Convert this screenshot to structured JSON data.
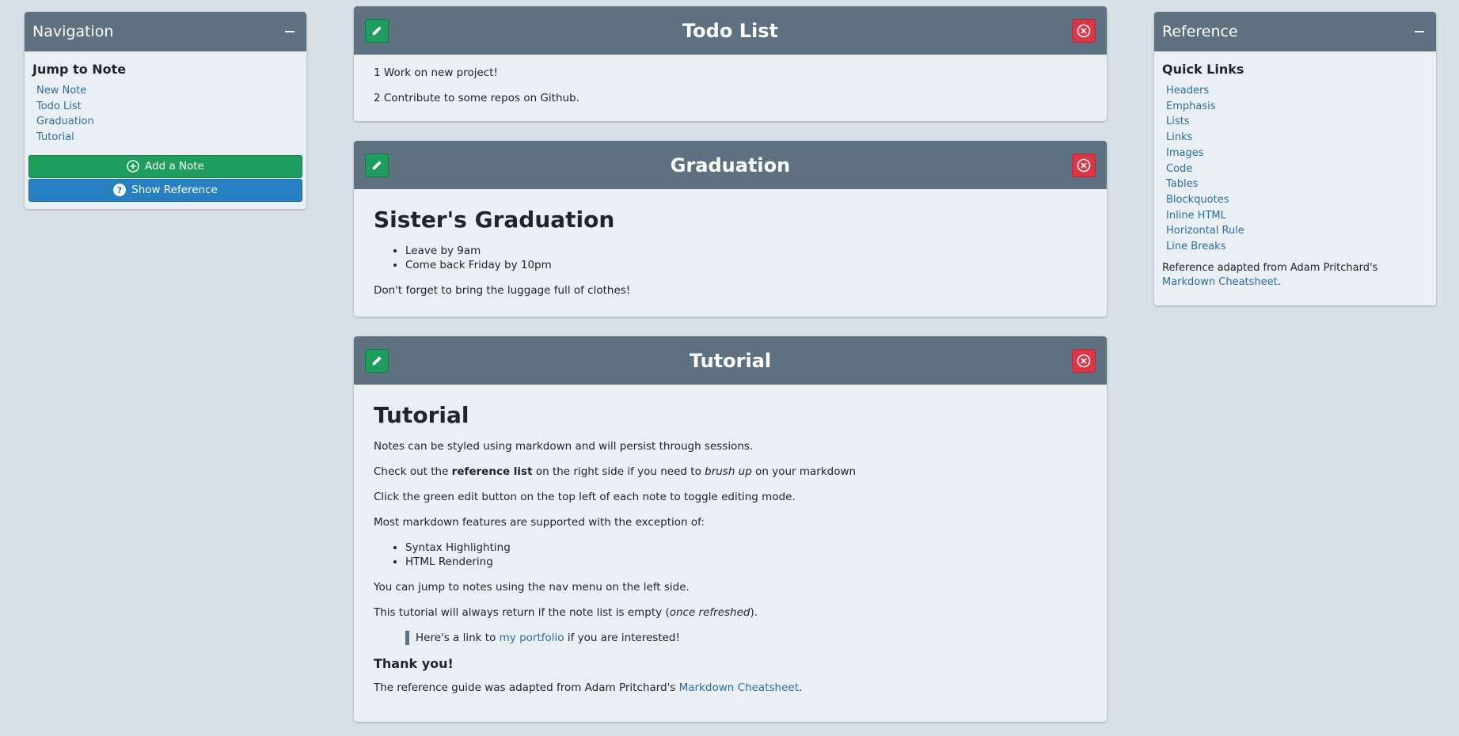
{
  "navigation": {
    "title": "Navigation",
    "subtitle": "Jump to Note",
    "links": [
      "New Note",
      "Todo List",
      "Graduation",
      "Tutorial"
    ],
    "add_button": "Add a Note",
    "reference_button": "Show Reference"
  },
  "reference": {
    "title": "Reference",
    "subtitle": "Quick Links",
    "links": [
      "Headers",
      "Emphasis",
      "Lists",
      "Links",
      "Images",
      "Code",
      "Tables",
      "Blockquotes",
      "Inline HTML",
      "Horizontal Rule",
      "Line Breaks"
    ],
    "footer_prefix": "Reference adapted from Adam Pritchard's ",
    "footer_link": "Markdown Cheatsheet",
    "footer_suffix": "."
  },
  "notes": {
    "todo": {
      "title": "Todo List",
      "lines": [
        "1 Work on new project!",
        "2 Contribute to some repos on Github."
      ]
    },
    "graduation": {
      "title": "Graduation",
      "heading": "Sister's Graduation",
      "items": [
        "Leave by 9am",
        "Come back Friday by 10pm"
      ],
      "footer": "Don't forget to bring the luggage full of clothes!"
    },
    "tutorial": {
      "title": "Tutorial",
      "heading": "Tutorial",
      "p1": "Notes can be styled using markdown and will persist through sessions.",
      "p2_a": "Check out the ",
      "p2_bold": "reference list",
      "p2_b": " on the right side if you need to ",
      "p2_em": "brush up",
      "p2_c": " on your markdown",
      "p3": "Click the green edit button on the top left of each note to toggle editing mode.",
      "p4": "Most markdown features are supported with the exception of:",
      "items": [
        "Syntax Highlighting",
        "HTML Rendering"
      ],
      "p5": "You can jump to notes using the nav menu on the left side.",
      "p6_a": "This tutorial will always return if the note list is empty (",
      "p6_em": "once refreshed",
      "p6_b": ").",
      "quote_a": "Here's a link to ",
      "quote_link": "my portfolio",
      "quote_b": " if you are interested!",
      "thanks": "Thank you!",
      "p7_a": "The reference guide was adapted from Adam Pritchard's ",
      "p7_link": "Markdown Cheatsheet",
      "p7_b": "."
    }
  },
  "colors": {
    "background": "#d8e0e7",
    "panel": "#eaeff4",
    "header": "#5e7180",
    "edit_green": "#1e9e5c",
    "delete_red": "#dc3545",
    "reference_blue": "#2680c2",
    "link": "#2a6fa0"
  },
  "icons": {
    "collapse": "minus-icon",
    "add": "plus-circle-icon",
    "help": "question-circle-icon",
    "edit": "pencil-icon",
    "delete": "x-circle-icon"
  }
}
